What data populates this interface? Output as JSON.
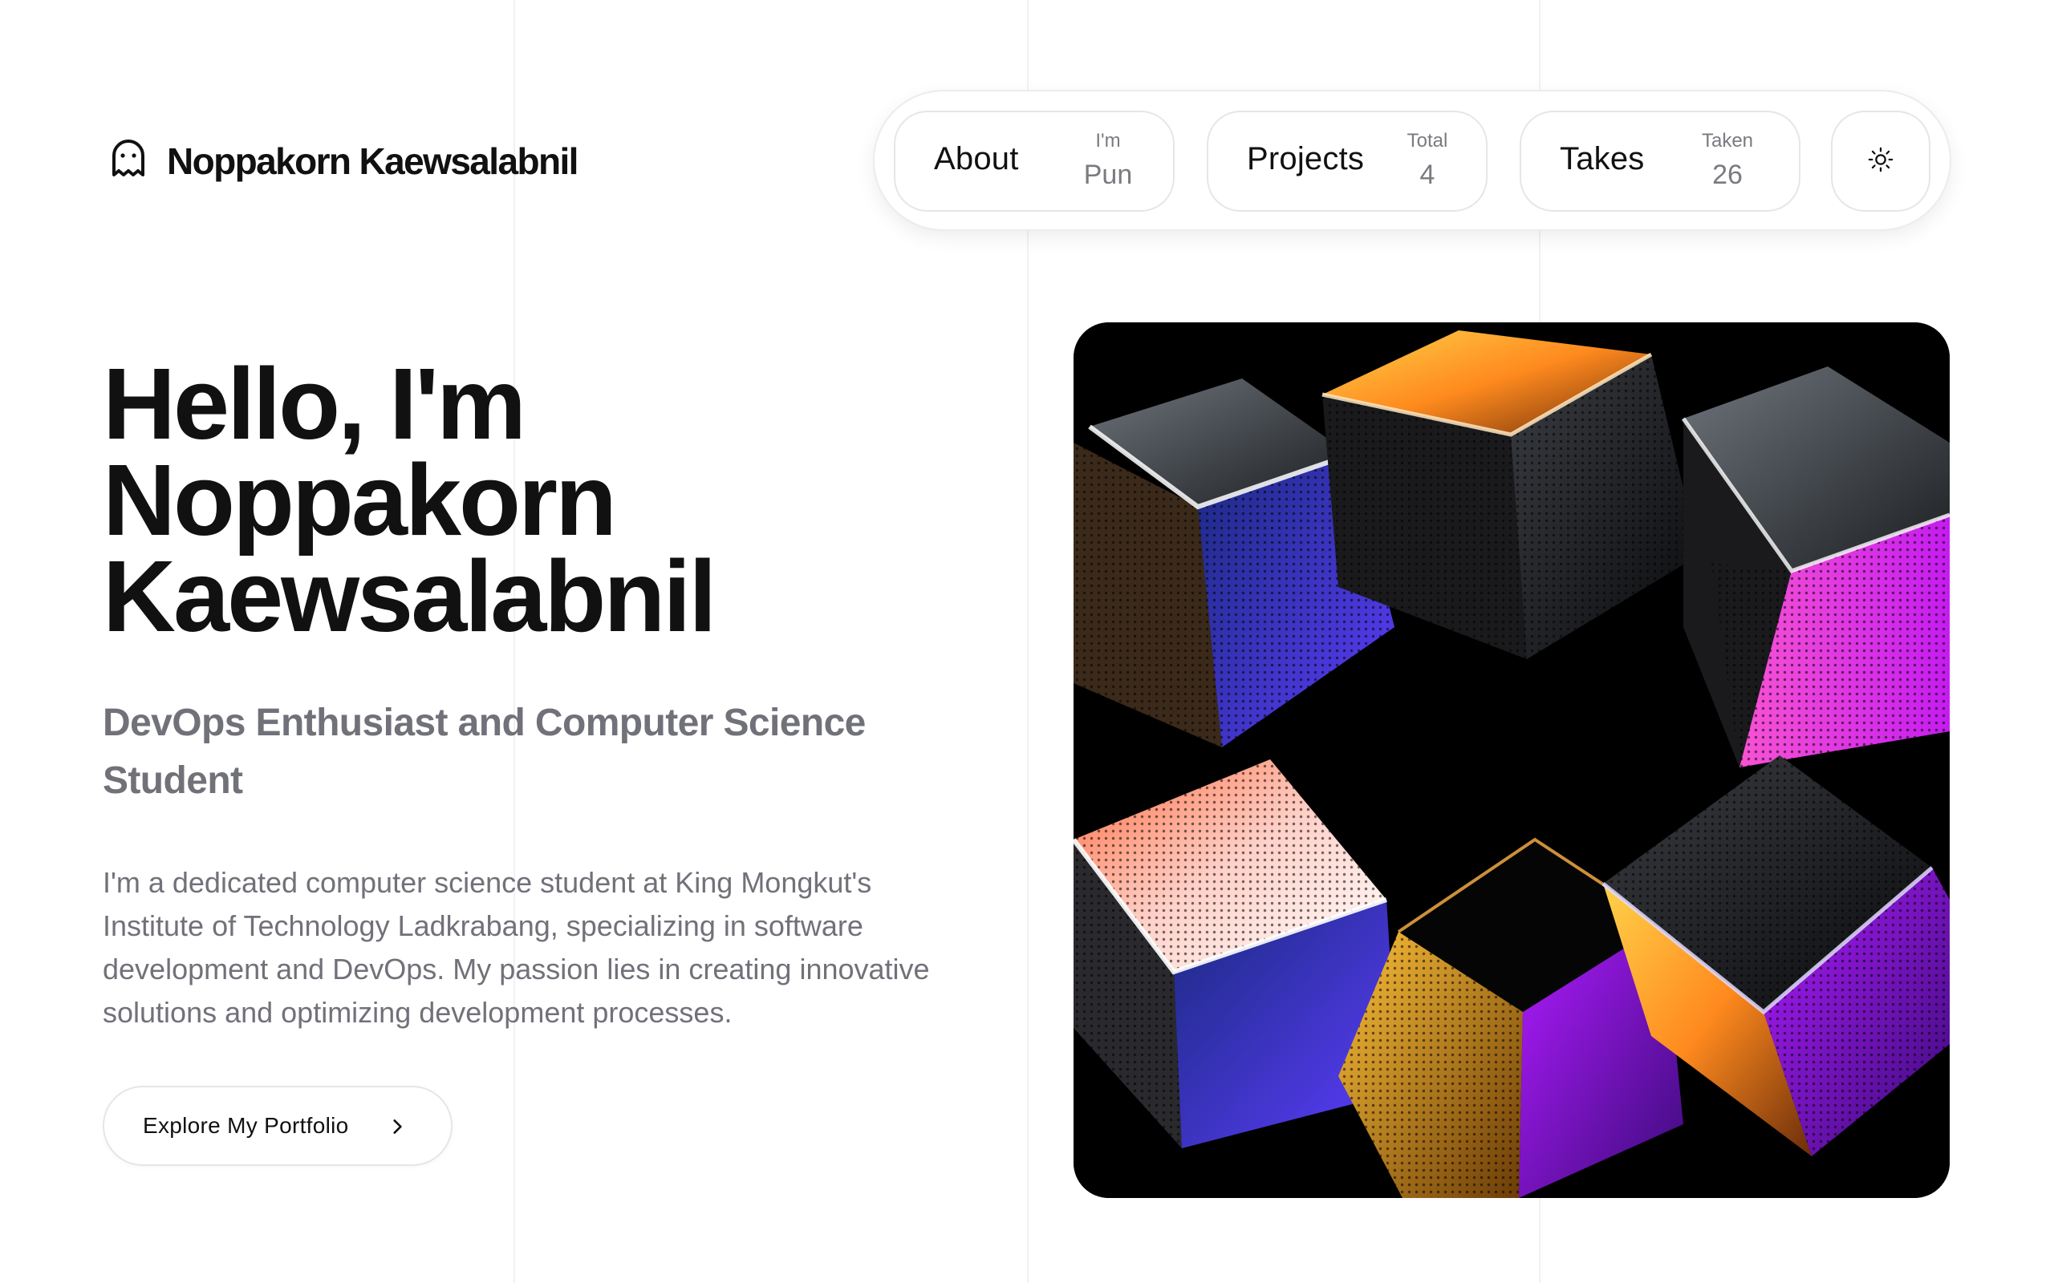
{
  "brand": {
    "name": "Noppakorn Kaewsalabnil",
    "icon": "ghost-icon"
  },
  "nav": {
    "items": [
      {
        "label": "About",
        "meta_top": "I'm",
        "meta_value": "Pun"
      },
      {
        "label": "Projects",
        "meta_top": "Total",
        "meta_value": "4"
      },
      {
        "label": "Takes",
        "meta_top": "Taken",
        "meta_value": "26"
      }
    ],
    "theme_toggle_icon": "sun-icon"
  },
  "hero": {
    "title_lines": [
      "Hello, I'm",
      "Noppakorn",
      "Kaewsalabnil"
    ],
    "subtitle": "DevOps Enthusiast and Computer Science Student",
    "description": "I'm a dedicated computer science student at King Mongkut's Institute of Technology Ladkrabang, specializing in software development and DevOps. My passion lies in creating innovative solutions and optimizing development processes.",
    "cta_label": "Explore My Portfolio",
    "cta_icon": "chevron-right-icon"
  },
  "artwork": {
    "icon": "iridescent-cubes-image"
  },
  "colors": {
    "text": "#111111",
    "muted": "#71717a",
    "border": "#e6e6e8",
    "background": "#ffffff"
  }
}
